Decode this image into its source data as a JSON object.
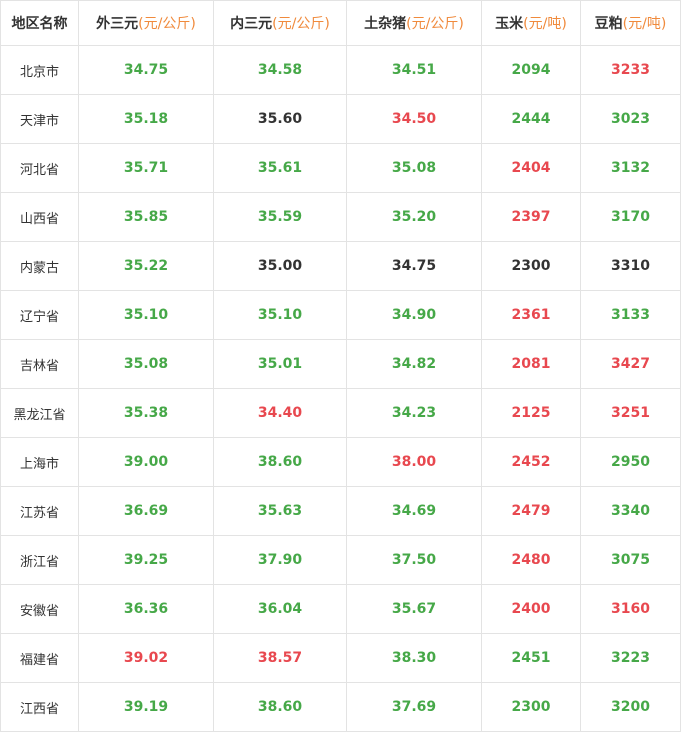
{
  "columns": [
    {
      "label": "地区名称",
      "unit": ""
    },
    {
      "label": "外三元",
      "unit": "(元/公斤)"
    },
    {
      "label": "内三元",
      "unit": "(元/公斤)"
    },
    {
      "label": "土杂猪",
      "unit": "(元/公斤)"
    },
    {
      "label": "玉米",
      "unit": "(元/吨)"
    },
    {
      "label": "豆粕",
      "unit": "(元/吨)"
    }
  ],
  "colors": {
    "green": "#46a848",
    "red": "#e8484f",
    "black": "#333333",
    "unit_orange": "#f08a3c"
  },
  "rows": [
    {
      "region": "北京市",
      "cells": [
        {
          "v": "34.75",
          "c": "green"
        },
        {
          "v": "34.58",
          "c": "green"
        },
        {
          "v": "34.51",
          "c": "green"
        },
        {
          "v": "2094",
          "c": "green"
        },
        {
          "v": "3233",
          "c": "red"
        }
      ]
    },
    {
      "region": "天津市",
      "cells": [
        {
          "v": "35.18",
          "c": "green"
        },
        {
          "v": "35.60",
          "c": "black"
        },
        {
          "v": "34.50",
          "c": "red"
        },
        {
          "v": "2444",
          "c": "green"
        },
        {
          "v": "3023",
          "c": "green"
        }
      ]
    },
    {
      "region": "河北省",
      "cells": [
        {
          "v": "35.71",
          "c": "green"
        },
        {
          "v": "35.61",
          "c": "green"
        },
        {
          "v": "35.08",
          "c": "green"
        },
        {
          "v": "2404",
          "c": "red"
        },
        {
          "v": "3132",
          "c": "green"
        }
      ]
    },
    {
      "region": "山西省",
      "cells": [
        {
          "v": "35.85",
          "c": "green"
        },
        {
          "v": "35.59",
          "c": "green"
        },
        {
          "v": "35.20",
          "c": "green"
        },
        {
          "v": "2397",
          "c": "red"
        },
        {
          "v": "3170",
          "c": "green"
        }
      ]
    },
    {
      "region": "内蒙古",
      "cells": [
        {
          "v": "35.22",
          "c": "green"
        },
        {
          "v": "35.00",
          "c": "black"
        },
        {
          "v": "34.75",
          "c": "black"
        },
        {
          "v": "2300",
          "c": "black"
        },
        {
          "v": "3310",
          "c": "black"
        }
      ]
    },
    {
      "region": "辽宁省",
      "cells": [
        {
          "v": "35.10",
          "c": "green"
        },
        {
          "v": "35.10",
          "c": "green"
        },
        {
          "v": "34.90",
          "c": "green"
        },
        {
          "v": "2361",
          "c": "red"
        },
        {
          "v": "3133",
          "c": "green"
        }
      ]
    },
    {
      "region": "吉林省",
      "cells": [
        {
          "v": "35.08",
          "c": "green"
        },
        {
          "v": "35.01",
          "c": "green"
        },
        {
          "v": "34.82",
          "c": "green"
        },
        {
          "v": "2081",
          "c": "red"
        },
        {
          "v": "3427",
          "c": "red"
        }
      ]
    },
    {
      "region": "黑龙江省",
      "cells": [
        {
          "v": "35.38",
          "c": "green"
        },
        {
          "v": "34.40",
          "c": "red"
        },
        {
          "v": "34.23",
          "c": "green"
        },
        {
          "v": "2125",
          "c": "red"
        },
        {
          "v": "3251",
          "c": "red"
        }
      ]
    },
    {
      "region": "上海市",
      "cells": [
        {
          "v": "39.00",
          "c": "green"
        },
        {
          "v": "38.60",
          "c": "green"
        },
        {
          "v": "38.00",
          "c": "red"
        },
        {
          "v": "2452",
          "c": "red"
        },
        {
          "v": "2950",
          "c": "green"
        }
      ]
    },
    {
      "region": "江苏省",
      "cells": [
        {
          "v": "36.69",
          "c": "green"
        },
        {
          "v": "35.63",
          "c": "green"
        },
        {
          "v": "34.69",
          "c": "green"
        },
        {
          "v": "2479",
          "c": "red"
        },
        {
          "v": "3340",
          "c": "green"
        }
      ]
    },
    {
      "region": "浙江省",
      "cells": [
        {
          "v": "39.25",
          "c": "green"
        },
        {
          "v": "37.90",
          "c": "green"
        },
        {
          "v": "37.50",
          "c": "green"
        },
        {
          "v": "2480",
          "c": "red"
        },
        {
          "v": "3075",
          "c": "green"
        }
      ]
    },
    {
      "region": "安徽省",
      "cells": [
        {
          "v": "36.36",
          "c": "green"
        },
        {
          "v": "36.04",
          "c": "green"
        },
        {
          "v": "35.67",
          "c": "green"
        },
        {
          "v": "2400",
          "c": "red"
        },
        {
          "v": "3160",
          "c": "red"
        }
      ]
    },
    {
      "region": "福建省",
      "cells": [
        {
          "v": "39.02",
          "c": "red"
        },
        {
          "v": "38.57",
          "c": "red"
        },
        {
          "v": "38.30",
          "c": "green"
        },
        {
          "v": "2451",
          "c": "green"
        },
        {
          "v": "3223",
          "c": "green"
        }
      ]
    },
    {
      "region": "江西省",
      "cells": [
        {
          "v": "39.19",
          "c": "green"
        },
        {
          "v": "38.60",
          "c": "green"
        },
        {
          "v": "37.69",
          "c": "green"
        },
        {
          "v": "2300",
          "c": "green"
        },
        {
          "v": "3200",
          "c": "green"
        }
      ]
    }
  ]
}
